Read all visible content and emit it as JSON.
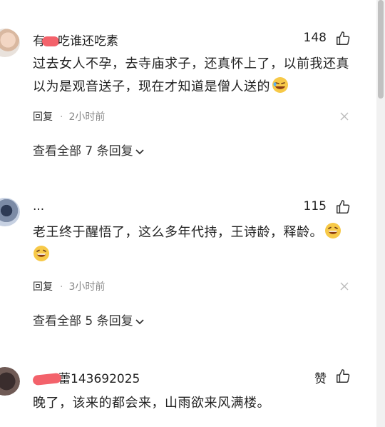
{
  "comments": [
    {
      "username_visible_prefix": "有",
      "username_visible_suffix": "吃谁还吃素",
      "likes": "148",
      "text": "过去女人不孕，去寺庙求子，还真怀上了，以前我还真以为是观音送子，现在才知道是僧人送的",
      "emoji_icon": "rofl-emoji",
      "reply_label": "回复",
      "time": "2小时前",
      "view_all_label": "查看全部 7 条回复"
    },
    {
      "username_visible": "...",
      "likes": "115",
      "text": "老王终于醒悟了，这么多年代持，王诗龄，释龄。",
      "emoji_icon": "laughing-emoji",
      "reply_label": "回复",
      "time": "3小时前",
      "view_all_label": "查看全部 5 条回复"
    },
    {
      "username_visible_suffix": "蕾143692025",
      "likes": "赞",
      "text": "晚了，该来的都会来，山雨欲来风满楼。"
    }
  ],
  "colors": {
    "redaction": "#f3626b",
    "text": "#222222",
    "meta": "#888888"
  }
}
